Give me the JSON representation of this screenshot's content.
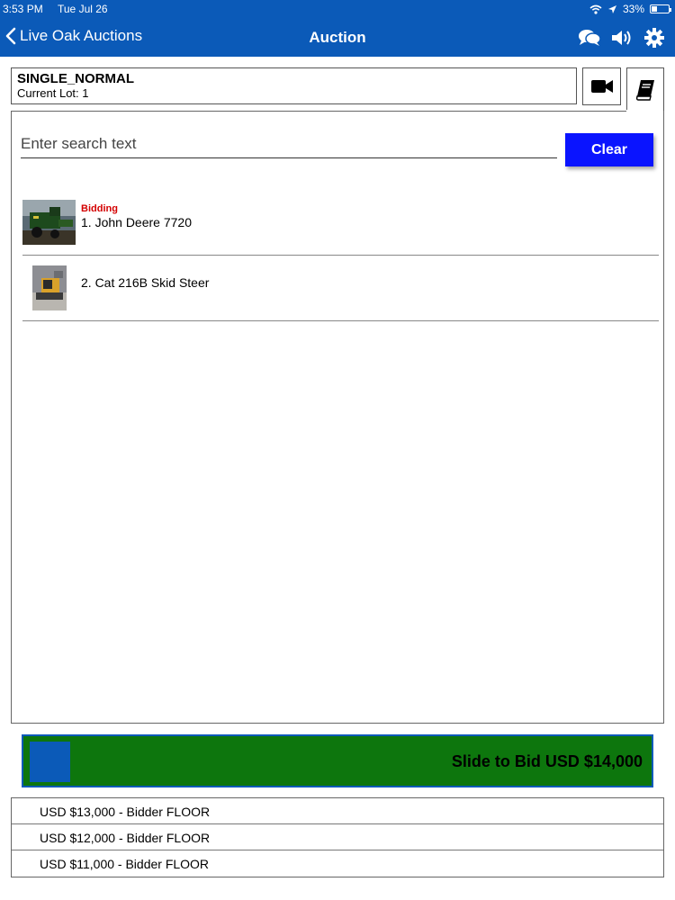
{
  "status_bar": {
    "time": "3:53 PM",
    "date": "Tue Jul 26",
    "battery": "33%",
    "battery_level": 0.33
  },
  "nav": {
    "back_label": "Live Oak Auctions",
    "title": "Auction",
    "icons": [
      "chat-icon",
      "speaker-icon",
      "gear-icon"
    ]
  },
  "auction": {
    "name": "SINGLE_NORMAL",
    "current_lot": "Current Lot: 1"
  },
  "tabs": {
    "video_icon": "video-camera-icon",
    "catalog_icon": "book-icon"
  },
  "search": {
    "placeholder": "Enter search text",
    "value": ""
  },
  "clear_label": "Clear",
  "lots": [
    {
      "status": "Bidding",
      "label": "1. John Deere 7720",
      "thumb": "combine-harvester-photo"
    },
    {
      "status": "",
      "label": "2. Cat 216B Skid Steer",
      "thumb": "skid-steer-photo"
    }
  ],
  "slider": {
    "label": "Slide to Bid USD $14,000"
  },
  "bids": [
    {
      "text": "USD $13,000 - Bidder FLOOR"
    },
    {
      "text": "USD $12,000 - Bidder FLOOR"
    },
    {
      "text": "USD $11,000 - Bidder FLOOR"
    }
  ],
  "colors": {
    "nav_blue": "#0b5ab8",
    "clear_blue": "#0a14ff",
    "slider_green": "#0d760d",
    "bidding_red": "#d40000"
  }
}
